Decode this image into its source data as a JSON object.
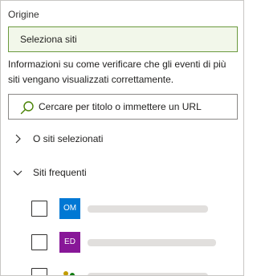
{
  "origin": {
    "label": "Origine",
    "value": "Seleziona siti"
  },
  "info": {
    "text": "Informazioni su come verificare che gli eventi di più siti vengano visualizzati correttamente."
  },
  "search": {
    "placeholder": "Cercare per titolo o immettere un URL",
    "icon": "search-icon"
  },
  "groups": {
    "selected_label": "O siti selezionati",
    "frequent_label": "Siti frequenti"
  },
  "sites": [
    {
      "initials": "OM",
      "color": "#0078d4"
    },
    {
      "initials": "ED",
      "color": "#881798"
    },
    {
      "initials": "",
      "color": "#ffffff"
    }
  ],
  "colors": {
    "accent": "#6b9a3e",
    "field_background": "#f2f7ea"
  }
}
